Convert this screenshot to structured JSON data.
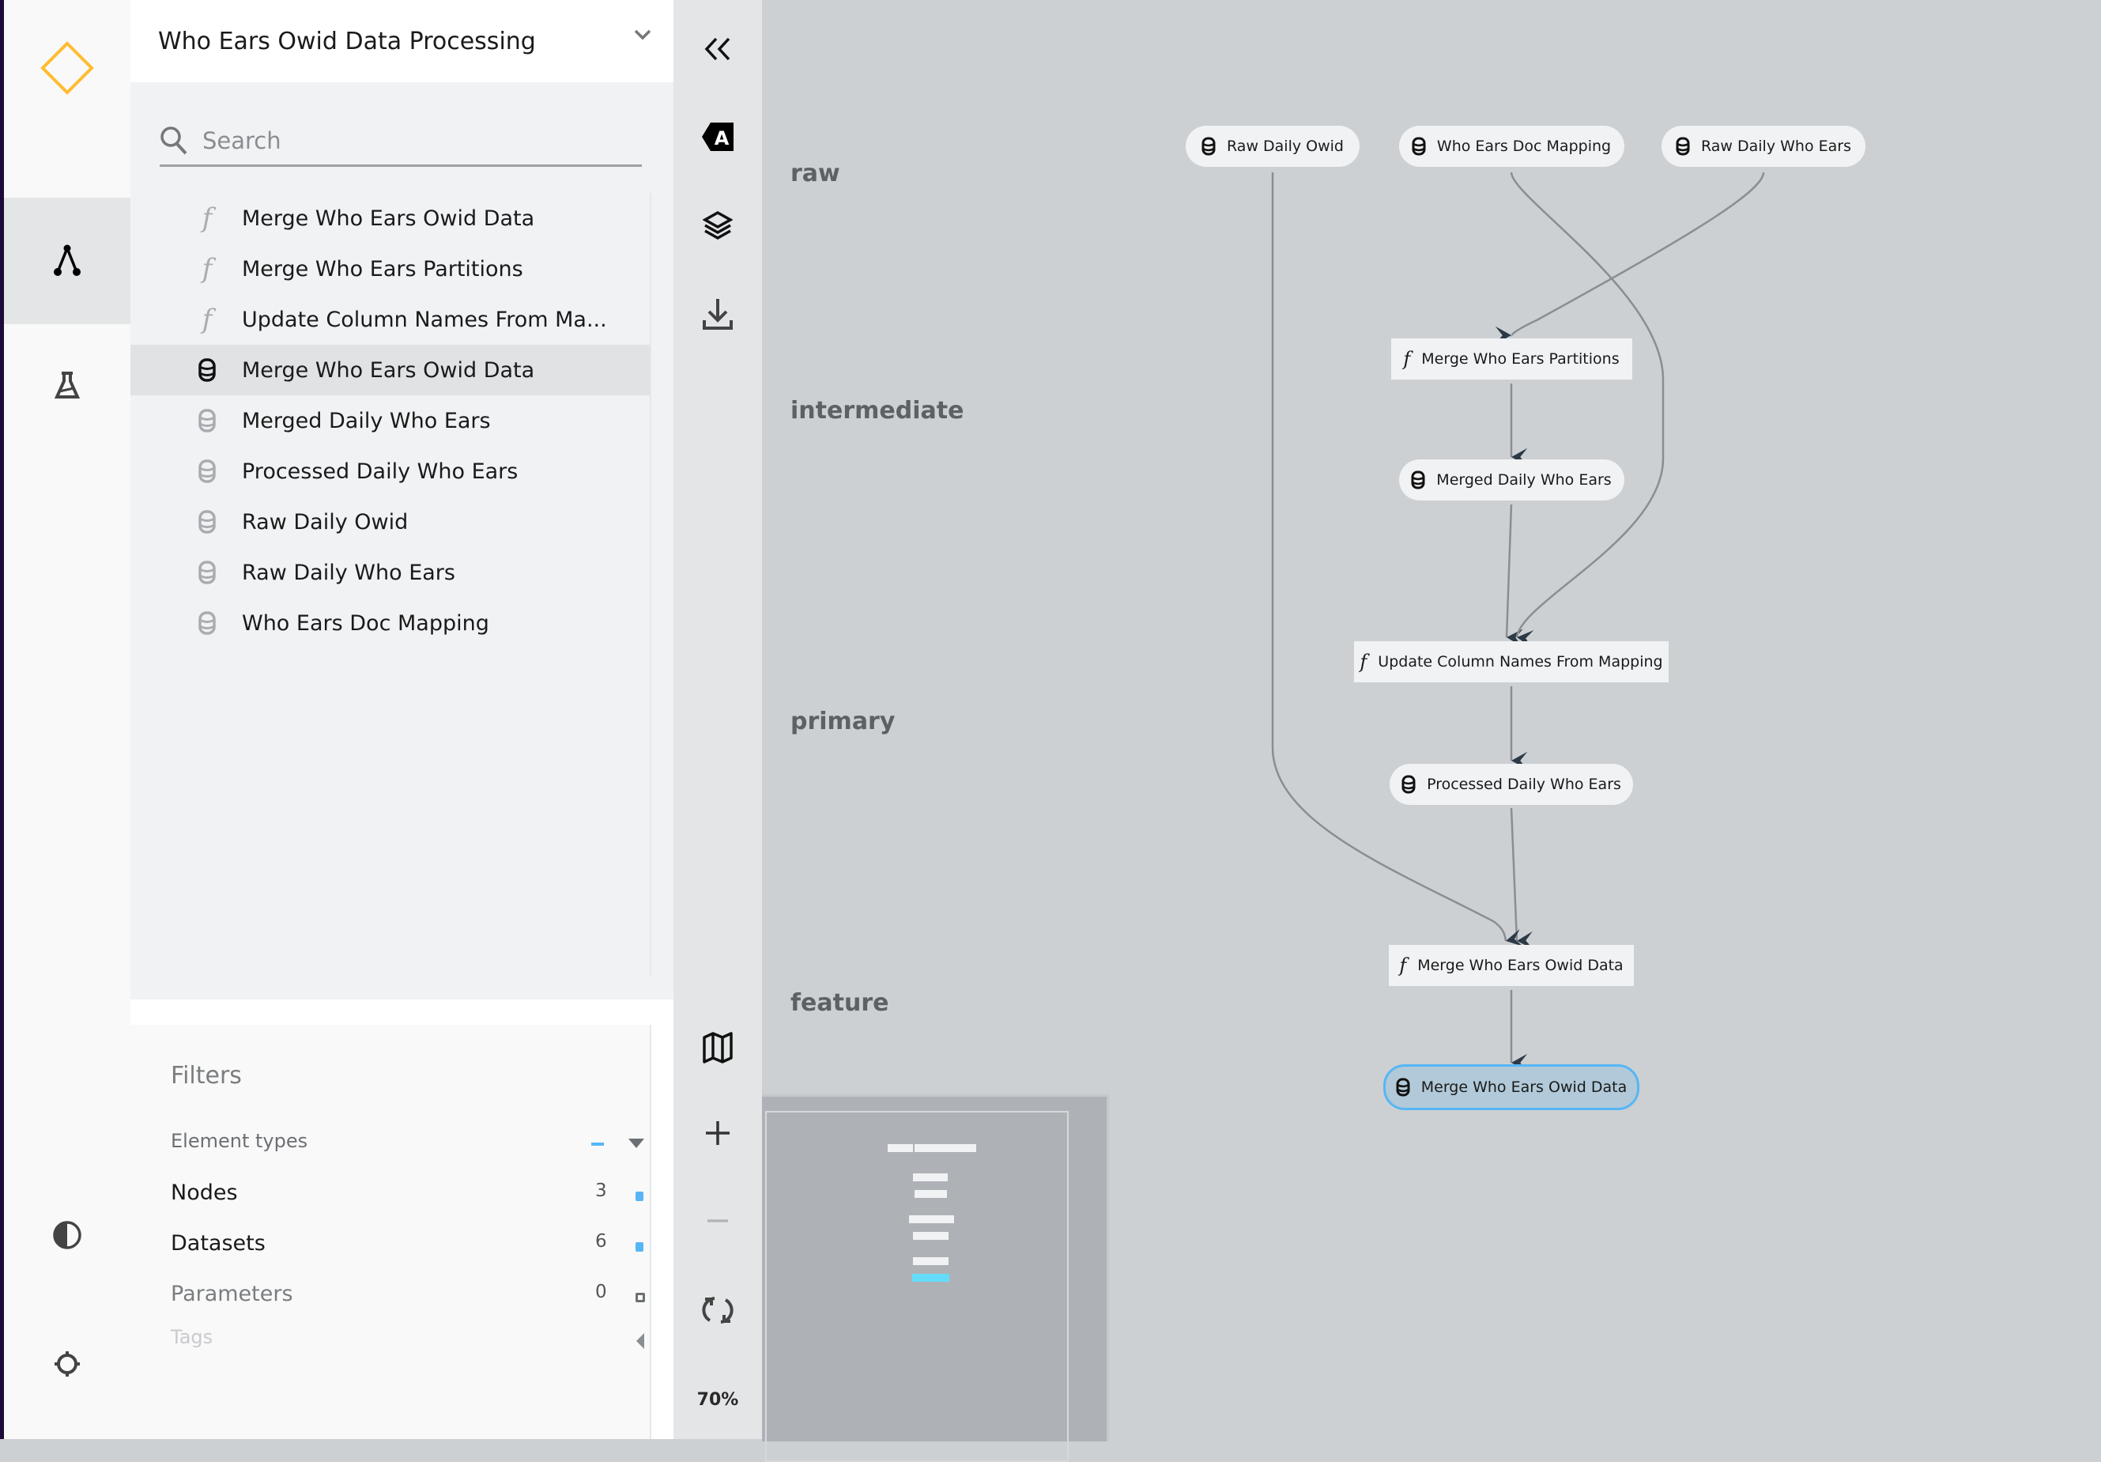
{
  "left_nav": {
    "items": [
      {
        "name": "logo",
        "icon": "kedro-diamond-icon"
      },
      {
        "name": "flowchart",
        "icon": "flowchart-icon",
        "active": true
      },
      {
        "name": "experiment-tracking",
        "icon": "flask-icon"
      },
      {
        "name": "theme-toggle",
        "icon": "contrast-icon"
      },
      {
        "name": "settings",
        "icon": "gear-icon"
      }
    ],
    "brand_color": "#ffbc2f"
  },
  "sidebar": {
    "pipeline_title": "Who Ears Owid Data Processing",
    "search_placeholder": "Search",
    "items": [
      {
        "type": "task",
        "label": "Merge Who Ears Owid Data",
        "selected": false
      },
      {
        "type": "task",
        "label": "Merge Who Ears Partitions",
        "selected": false
      },
      {
        "type": "task",
        "label": "Update Column Names From Ma...",
        "selected": false
      },
      {
        "type": "dataset",
        "label": "Merge Who Ears Owid Data",
        "selected": true
      },
      {
        "type": "dataset",
        "label": "Merged Daily Who Ears",
        "selected": false
      },
      {
        "type": "dataset",
        "label": "Processed Daily Who Ears",
        "selected": false
      },
      {
        "type": "dataset",
        "label": "Raw Daily Owid",
        "selected": false
      },
      {
        "type": "dataset",
        "label": "Raw Daily Who Ears",
        "selected": false
      },
      {
        "type": "dataset",
        "label": "Who Ears Doc Mapping",
        "selected": false
      }
    ],
    "filters": {
      "title": "Filters",
      "element_types_label": "Element types",
      "rows": [
        {
          "label": "Nodes",
          "count": "3",
          "checked": true
        },
        {
          "label": "Datasets",
          "count": "6",
          "checked": true
        },
        {
          "label": "Parameters",
          "count": "0",
          "checked": false
        }
      ],
      "tags_label": "Tags"
    }
  },
  "toolbar": {
    "buttons": [
      "collapse-sidebar",
      "toggle-labels",
      "toggle-layers",
      "export",
      "minimap",
      "zoom-in",
      "zoom-out",
      "reset-view"
    ],
    "zoom_level": "70%"
  },
  "graph": {
    "layers": [
      "raw",
      "intermediate",
      "primary",
      "feature"
    ],
    "nodes": [
      {
        "id": "raw_daily_owid",
        "type": "dataset",
        "label": "Raw Daily Owid",
        "layer": "raw"
      },
      {
        "id": "who_ears_doc_mapping",
        "type": "dataset",
        "label": "Who Ears Doc Mapping",
        "layer": "raw"
      },
      {
        "id": "raw_daily_who_ears",
        "type": "dataset",
        "label": "Raw Daily Who Ears",
        "layer": "raw"
      },
      {
        "id": "merge_who_ears_partitions",
        "type": "task",
        "label": "Merge Who Ears Partitions",
        "layer": "intermediate"
      },
      {
        "id": "merged_daily_who_ears",
        "type": "dataset",
        "label": "Merged Daily Who Ears",
        "layer": "intermediate"
      },
      {
        "id": "update_column_names",
        "type": "task",
        "label": "Update Column Names From Mapping",
        "layer": "primary"
      },
      {
        "id": "processed_daily_who_ears",
        "type": "dataset",
        "label": "Processed Daily Who Ears",
        "layer": "primary"
      },
      {
        "id": "merge_who_ears_owid_data_fn",
        "type": "task",
        "label": "Merge Who Ears Owid Data",
        "layer": "feature"
      },
      {
        "id": "merge_who_ears_owid_data_ds",
        "type": "dataset",
        "label": "Merge Who Ears Owid Data",
        "layer": "feature",
        "selected": true
      }
    ],
    "edges": [
      [
        "raw_daily_who_ears",
        "merge_who_ears_partitions"
      ],
      [
        "merge_who_ears_partitions",
        "merged_daily_who_ears"
      ],
      [
        "merged_daily_who_ears",
        "update_column_names"
      ],
      [
        "who_ears_doc_mapping",
        "update_column_names"
      ],
      [
        "update_column_names",
        "processed_daily_who_ears"
      ],
      [
        "processed_daily_who_ears",
        "merge_who_ears_owid_data_fn"
      ],
      [
        "raw_daily_owid",
        "merge_who_ears_owid_data_fn"
      ],
      [
        "merge_who_ears_owid_data_fn",
        "merge_who_ears_owid_data_ds"
      ]
    ],
    "selection_color": "#56b6f5"
  }
}
